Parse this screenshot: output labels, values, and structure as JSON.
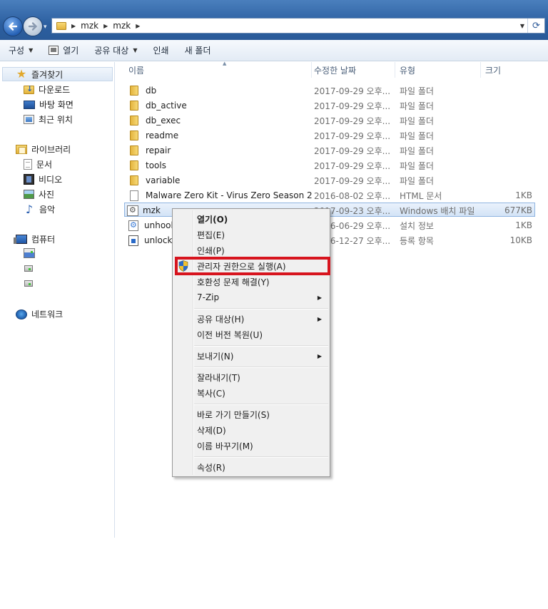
{
  "address": {
    "back_icon": "back-arrow-icon",
    "forward_icon": "forward-arrow-icon",
    "breadcrumbs": [
      "mzk",
      "mzk"
    ],
    "refresh_icon": "refresh-icon"
  },
  "toolbar": {
    "organize": "구성",
    "open": "열기",
    "share": "공유 대상",
    "print": "인쇄",
    "new_folder": "새 폴더"
  },
  "sidebar": {
    "favorites": "즐겨찾기",
    "favorites_items": [
      "다운로드",
      "바탕 화면",
      "최근 위치"
    ],
    "libraries": "라이브러리",
    "library_items": [
      "문서",
      "비디오",
      "사진",
      "음악"
    ],
    "computer": "컴퓨터",
    "network": "네트워크"
  },
  "columns": {
    "name": "이름",
    "modified": "수정한 날짜",
    "type": "유형",
    "size": "크기"
  },
  "files": [
    {
      "name": "db",
      "modified": "2017-09-29 오후...",
      "type": "파일 폴더",
      "size": "",
      "icon": "folder-icon"
    },
    {
      "name": "db_active",
      "modified": "2017-09-29 오후...",
      "type": "파일 폴더",
      "size": "",
      "icon": "folder-icon"
    },
    {
      "name": "db_exec",
      "modified": "2017-09-29 오후...",
      "type": "파일 폴더",
      "size": "",
      "icon": "folder-icon"
    },
    {
      "name": "readme",
      "modified": "2017-09-29 오후...",
      "type": "파일 폴더",
      "size": "",
      "icon": "folder-icon"
    },
    {
      "name": "repair",
      "modified": "2017-09-29 오후...",
      "type": "파일 폴더",
      "size": "",
      "icon": "folder-icon"
    },
    {
      "name": "tools",
      "modified": "2017-09-29 오후...",
      "type": "파일 폴더",
      "size": "",
      "icon": "folder-icon"
    },
    {
      "name": "variable",
      "modified": "2017-09-29 오후...",
      "type": "파일 폴더",
      "size": "",
      "icon": "folder-icon"
    },
    {
      "name": "Malware Zero Kit - Virus Zero Season 2",
      "modified": "2016-08-02 오후...",
      "type": "HTML 문서",
      "size": "1KB",
      "icon": "html-file-icon"
    },
    {
      "name": "mzk",
      "modified": "2017-09-23 오후...",
      "type": "Windows 배치 파일",
      "size": "677KB",
      "icon": "batch-file-icon"
    },
    {
      "name": "unhook",
      "modified": "2016-06-29 오후...",
      "type": "설치 정보",
      "size": "1KB",
      "icon": "setup-info-icon"
    },
    {
      "name": "unlock",
      "modified": "2016-12-27 오후...",
      "type": "등록 항목",
      "size": "10KB",
      "icon": "registry-file-icon"
    }
  ],
  "menu": {
    "open": "열기(O)",
    "edit": "편집(E)",
    "print": "인쇄(P)",
    "run_as_admin": "관리자 권한으로 실행(A)",
    "troubleshoot": "호환성 문제 해결(Y)",
    "sevenzip": "7-Zip",
    "share": "공유 대상(H)",
    "restore": "이전 버전 복원(U)",
    "send_to": "보내기(N)",
    "cut": "잘라내기(T)",
    "copy": "복사(C)",
    "shortcut": "바로 가기 만들기(S)",
    "delete": "삭제(D)",
    "rename": "이름 바꾸기(M)",
    "properties": "속성(R)"
  },
  "colors": {
    "highlight_box": "#d7141e",
    "selection": "#d3e3f6",
    "titlebar": "#2c5fa0"
  }
}
